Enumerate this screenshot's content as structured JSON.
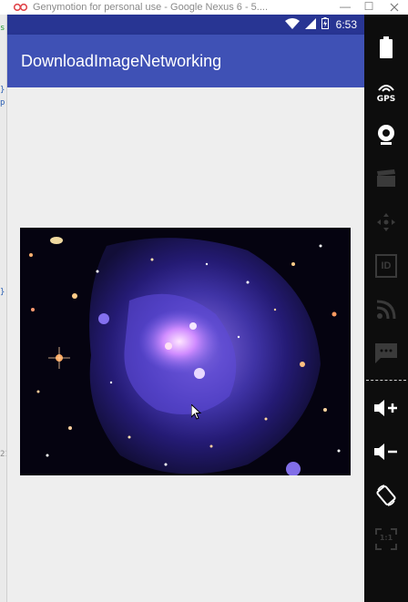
{
  "window": {
    "title": "Genymotion for personal use - Google Nexus 6 - 5....",
    "minimize_glyph": "—",
    "maximize_glyph": "☐"
  },
  "statusbar": {
    "time": "6:53",
    "icons": [
      "wifi-icon",
      "signal-icon",
      "battery-icon"
    ]
  },
  "appbar": {
    "title": "DownloadImageNetworking"
  },
  "image": {
    "description_icon": "galaxy-cluster-image"
  },
  "toolbar": {
    "items": [
      "battery-icon",
      "gps-icon",
      "webcam-icon",
      "video-capture-icon",
      "dpad-icon",
      "device-id-icon",
      "rss-icon",
      "sms-icon",
      "volume-up-icon",
      "volume-down-icon",
      "rotate-icon",
      "scale-icon"
    ],
    "gps_label": "GPS",
    "id_label": "ID",
    "scale_label": "1:1"
  },
  "colors": {
    "statusbar": "#283593",
    "appbar": "#3f51b5",
    "background": "#eeeeee",
    "toolbar": "#0d0d0d"
  }
}
